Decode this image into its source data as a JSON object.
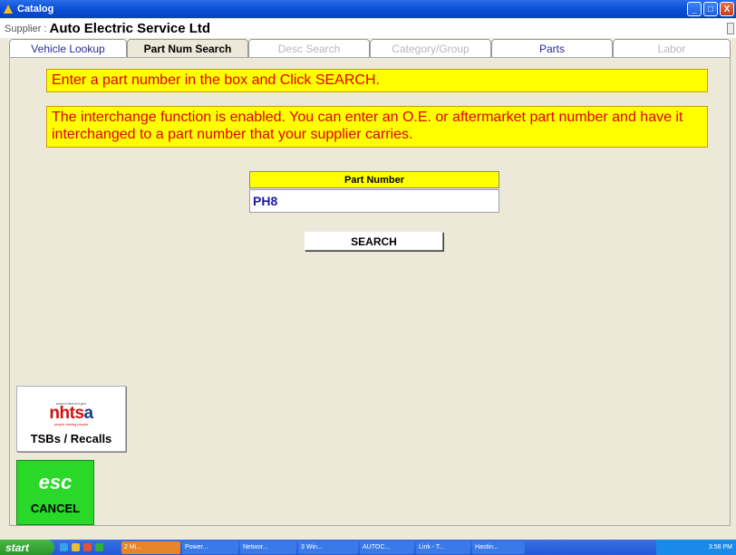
{
  "window": {
    "title": "Catalog",
    "controls": [
      "_",
      "□",
      "X"
    ]
  },
  "supplier": {
    "label": "Supplier :",
    "name": "Auto Electric Service Ltd"
  },
  "tabs": [
    {
      "label": "Vehicle Lookup",
      "state": "enabled"
    },
    {
      "label": "Part Num Search",
      "state": "active"
    },
    {
      "label": "Desc Search",
      "state": "disabled"
    },
    {
      "label": "Category/Group",
      "state": "disabled"
    },
    {
      "label": "Parts",
      "state": "enabled"
    },
    {
      "label": "Labor",
      "state": "disabled"
    }
  ],
  "notices": {
    "instruction": "Enter a part number in the box and Click SEARCH.",
    "interchange": "The interchange function is enabled. You can enter an O.E. or aftermarket part number and have it interchanged to a part number that your supplier carries."
  },
  "part_number": {
    "header": "Part Number",
    "value": "PH8"
  },
  "search_button": "SEARCH",
  "tsb": {
    "logo_url": "www.nhtsa.dot.gov",
    "logo_red": "nhts",
    "logo_blue": "a",
    "logo_tagline": "people saving people",
    "label": "TSBs / Recalls"
  },
  "esc": {
    "key": "esc",
    "label": "CANCEL"
  },
  "taskbar": {
    "start": "start",
    "tasks": [
      {
        "label": "2 Mi...",
        "active": true
      },
      {
        "label": "Power..."
      },
      {
        "label": "Networ..."
      },
      {
        "label": "3 Win..."
      },
      {
        "label": "AUTOC..."
      },
      {
        "label": "Link - T..."
      },
      {
        "label": "Hastin..."
      }
    ],
    "clock": "3:58 PM"
  },
  "colors": {
    "notice_bg": "#ffff00",
    "notice_text": "#e00000",
    "esc_bg": "#2ad82a",
    "titlebar": "#0a4fd6"
  }
}
